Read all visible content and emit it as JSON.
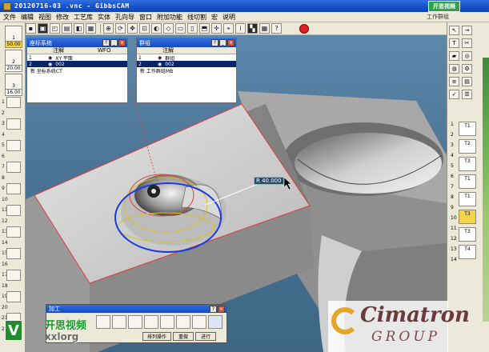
{
  "window": {
    "title": "20120716-03 .vnc - GibbsCAM",
    "badge": "开思视频"
  },
  "menu": {
    "items": [
      "文件",
      "编辑",
      "视图",
      "修改",
      "工艺库",
      "实体",
      "孔向导",
      "窗口",
      "附加功能",
      "线切割",
      "宏",
      "说明"
    ],
    "right_label": "工作群组"
  },
  "left_tools": [
    {
      "label": "1",
      "value": "50.00",
      "active": true
    },
    {
      "label": "2",
      "value": "20.00",
      "active": false
    },
    {
      "label": "3",
      "value": "16.00",
      "active": false
    }
  ],
  "left_numbers": [
    "1",
    "2",
    "3",
    "4",
    "5",
    "6",
    "7",
    "8",
    "9",
    "10",
    "11",
    "12",
    "13",
    "14",
    "15",
    "16",
    "17",
    "18",
    "19",
    "20",
    "21",
    "22"
  ],
  "right_tools": [
    {
      "label": "T1",
      "active": false
    },
    {
      "label": "T2",
      "active": false
    },
    {
      "label": "T3",
      "active": false
    },
    {
      "label": "T1",
      "active": false
    },
    {
      "label": "T1",
      "active": false
    },
    {
      "label": "T3",
      "active": true
    },
    {
      "label": "T3",
      "active": false
    },
    {
      "label": "T4",
      "active": false
    }
  ],
  "right_numbers": [
    "1",
    "2",
    "3",
    "4",
    "5",
    "6",
    "7",
    "8",
    "9",
    "10",
    "11",
    "12",
    "13",
    "14"
  ],
  "coord_panel": {
    "title": "座标系统",
    "headers": [
      "注解",
      "WFO"
    ],
    "rows": [
      {
        "idx": "1",
        "name": "XY 平面",
        "selected": false
      },
      {
        "idx": "2",
        "name": "002",
        "selected": true
      }
    ],
    "note": "新 坐标系统CT"
  },
  "group_panel": {
    "title": "群组",
    "headers": [
      "注解"
    ],
    "rows": [
      {
        "idx": "1",
        "name": "群组",
        "selected": false
      },
      {
        "idx": "2",
        "name": "002",
        "selected": true
      }
    ],
    "note": "新 工作群组MB"
  },
  "dimension": {
    "value": "R 40.000"
  },
  "process": {
    "title": "加工",
    "buttons": [
      "排列操作",
      "重做",
      "进行"
    ]
  },
  "watermark": {
    "cn": "开思视频",
    "en": "xxlorg",
    "logo": "V"
  },
  "brand": {
    "name": "Cimatron",
    "sub": "GROUP"
  }
}
